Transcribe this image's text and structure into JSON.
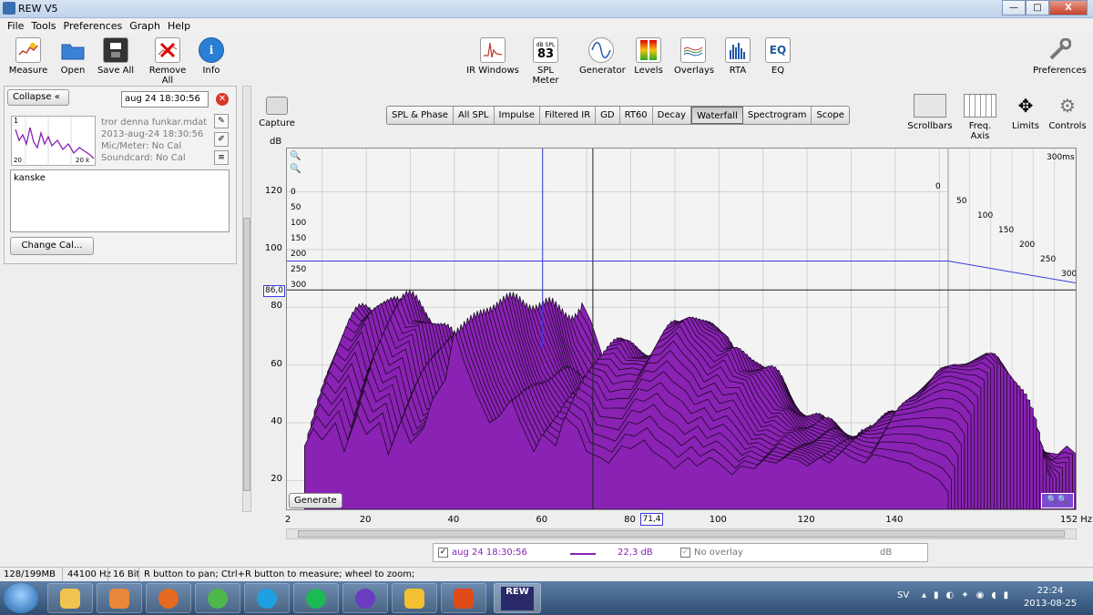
{
  "window": {
    "title": "REW V5",
    "min": "—",
    "max": "□",
    "close": "X"
  },
  "menu": [
    "File",
    "Tools",
    "Preferences",
    "Graph",
    "Help"
  ],
  "toolbar_left": [
    {
      "label": "Measure",
      "icon": "measure-icon"
    },
    {
      "label": "Open",
      "icon": "folder-icon"
    },
    {
      "label": "Save All",
      "icon": "save-icon"
    },
    {
      "label": "Remove All",
      "icon": "remove-icon"
    },
    {
      "label": "Info",
      "icon": "info-icon"
    }
  ],
  "toolbar_center": [
    {
      "label": "IR Windows",
      "icon": "ir-windows-icon"
    },
    {
      "label": "SPL Meter",
      "icon": "spl-meter-icon",
      "glyph_top": "dB SPL",
      "glyph": "83"
    },
    {
      "label": "Generator",
      "icon": "generator-icon"
    },
    {
      "label": "Levels",
      "icon": "levels-icon"
    },
    {
      "label": "Overlays",
      "icon": "overlays-icon"
    },
    {
      "label": "RTA",
      "icon": "rta-icon"
    },
    {
      "label": "EQ",
      "icon": "eq-icon",
      "glyph": "EQ"
    }
  ],
  "toolbar_right": {
    "label": "Preferences",
    "icon": "wrench-icon"
  },
  "panel": {
    "collapse_label": "Collapse",
    "collapse_glyph": "«",
    "search_value": "aug 24 18:30:56",
    "meas_number": "1",
    "meas_name": "tror denna funkar.mdat",
    "meas_date": "2013-aug-24 18:30:56",
    "mic": "Mic/Meter: No Cal",
    "soundcard": "Soundcard: No Cal",
    "notes": "kanske",
    "change_cal": "Change Cal...",
    "thumb_left": "20",
    "thumb_right": "20 k"
  },
  "capture_label": "Capture",
  "tabs": [
    {
      "label": "SPL & Phase",
      "active": false
    },
    {
      "label": "All SPL",
      "active": false
    },
    {
      "label": "Impulse",
      "active": false
    },
    {
      "label": "Filtered IR",
      "active": false
    },
    {
      "label": "GD",
      "active": false
    },
    {
      "label": "RT60",
      "active": false
    },
    {
      "label": "Decay",
      "active": false
    },
    {
      "label": "Waterfall",
      "active": true
    },
    {
      "label": "Spectrogram",
      "active": false
    },
    {
      "label": "Scope",
      "active": false
    }
  ],
  "graph_controls": [
    {
      "label": "Scrollbars",
      "icon": "scrollbars-icon"
    },
    {
      "label": "Freq. Axis",
      "icon": "freq-axis-icon"
    },
    {
      "label": "Limits",
      "icon": "limits-icon"
    },
    {
      "label": "Controls",
      "icon": "controls-gear-icon"
    }
  ],
  "generate_label": "Generate",
  "chart_data": {
    "type": "area",
    "title": "",
    "xlabel": "",
    "x_unit": "Hz",
    "ylabel": "dB",
    "ylim": [
      10,
      135
    ],
    "xlim": [
      2,
      152
    ],
    "x_ticks": [
      "2",
      "20",
      "40",
      "60",
      "80",
      "100",
      "120",
      "140",
      "152 Hz"
    ],
    "x_tick_values": [
      2,
      20,
      40,
      60,
      80,
      100,
      120,
      140,
      152
    ],
    "y_ticks": [
      20,
      40,
      60,
      80,
      100,
      120
    ],
    "time_labels": [
      "0",
      "50",
      "100",
      "150",
      "200",
      "250",
      "300"
    ],
    "time_end": "300ms",
    "grid": true,
    "cursor": {
      "x": "71,4",
      "y": "86,0"
    },
    "front_slice_x": [
      6,
      8,
      10,
      13,
      15,
      18,
      20,
      23,
      25,
      28,
      30,
      33,
      35,
      38,
      40,
      42,
      45,
      48,
      50,
      53,
      55,
      58,
      60,
      63,
      65,
      68,
      70,
      73,
      75,
      78,
      80,
      83,
      85,
      88,
      90,
      93,
      95,
      98,
      100,
      103,
      105,
      108,
      110,
      113,
      115,
      118,
      120,
      123,
      125,
      128,
      130,
      133,
      135,
      138,
      140,
      143,
      145,
      148,
      150,
      152
    ],
    "front_slice_y": [
      32,
      38,
      34,
      40,
      30,
      43,
      36,
      40,
      29,
      41,
      33,
      38,
      48,
      55,
      72,
      62,
      50,
      40,
      42,
      48,
      40,
      30,
      36,
      32,
      42,
      38,
      30,
      28,
      26,
      32,
      31,
      34,
      30,
      27,
      24,
      28,
      25,
      28,
      26,
      22,
      25,
      24,
      27,
      26,
      28,
      27,
      25,
      28,
      26,
      30,
      28,
      26,
      29,
      28,
      27,
      26,
      24,
      22,
      20,
      16
    ]
  },
  "legend": {
    "name": "aug 24 18:30:56",
    "value": "22,3 dB",
    "overlay": "No overlay",
    "unit": "dB"
  },
  "status": {
    "memory": "128/199MB",
    "rate": "44100 Hz",
    "bits": "16 Bit",
    "hint": "R button to pan; Ctrl+R button to measure; wheel to zoom;"
  },
  "taskbar": {
    "lang": "SV",
    "time": "22:24",
    "date": "2013-08-25",
    "rew_label": "REW"
  },
  "colors": {
    "fill": "#8a22b4",
    "accent": "#3a3ae0"
  }
}
